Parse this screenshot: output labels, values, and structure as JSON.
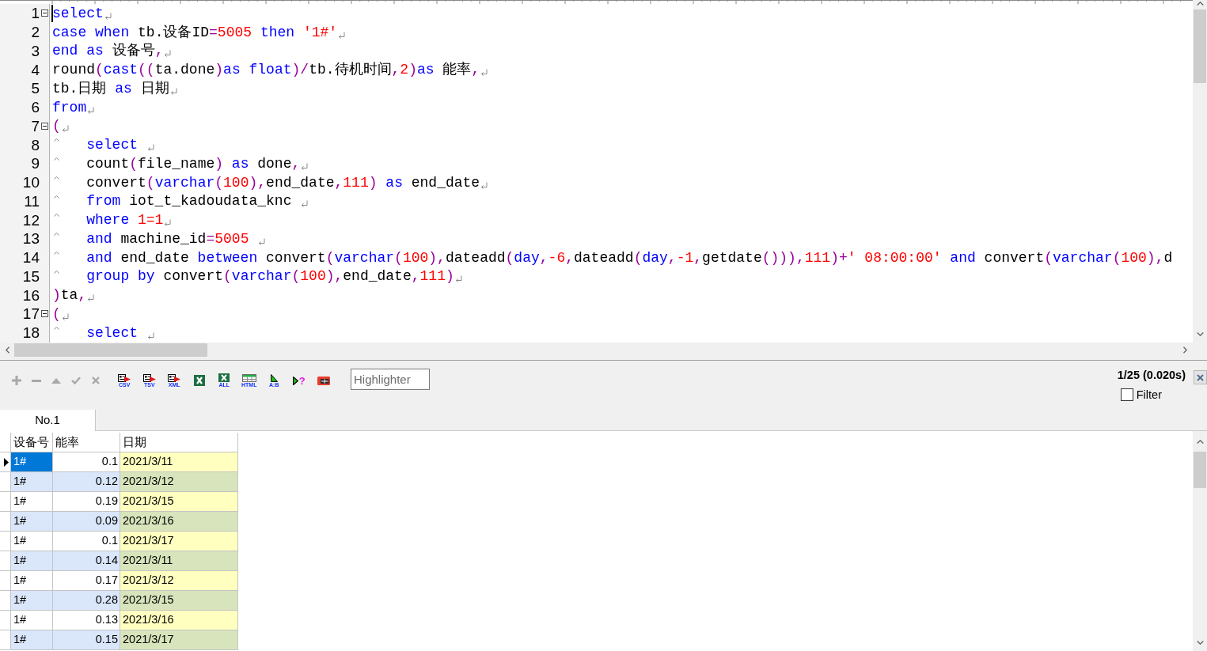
{
  "editor": {
    "lines": [
      {
        "number": "1",
        "fold": true,
        "indent": false,
        "cursor": true,
        "eol": true,
        "tokens": [
          {
            "kind": "keyword",
            "text": "select"
          }
        ]
      },
      {
        "number": "2",
        "fold": false,
        "indent": false,
        "cursor": false,
        "eol": true,
        "tokens": [
          {
            "kind": "keyword",
            "text": "case"
          },
          {
            "kind": "keyword",
            "text": " when"
          },
          {
            "kind": "plain",
            "text": " tb.设备ID"
          },
          {
            "kind": "operator",
            "text": "="
          },
          {
            "kind": "literal",
            "text": "5005"
          },
          {
            "kind": "keyword",
            "text": " then"
          },
          {
            "kind": "literal",
            "text": " '1#'"
          }
        ]
      },
      {
        "number": "3",
        "fold": false,
        "indent": false,
        "cursor": false,
        "eol": true,
        "tokens": [
          {
            "kind": "keyword",
            "text": "end"
          },
          {
            "kind": "keyword",
            "text": " as"
          },
          {
            "kind": "plain",
            "text": " 设备号"
          },
          {
            "kind": "operator",
            "text": ","
          }
        ]
      },
      {
        "number": "4",
        "fold": false,
        "indent": false,
        "cursor": false,
        "eol": true,
        "tokens": [
          {
            "kind": "plain",
            "text": "round"
          },
          {
            "kind": "operator",
            "text": "("
          },
          {
            "kind": "keyword",
            "text": "cast"
          },
          {
            "kind": "operator",
            "text": "(("
          },
          {
            "kind": "plain",
            "text": "ta.done"
          },
          {
            "kind": "operator",
            "text": ")"
          },
          {
            "kind": "keyword",
            "text": "as"
          },
          {
            "kind": "keyword",
            "text": " float"
          },
          {
            "kind": "operator",
            "text": ")/"
          },
          {
            "kind": "plain",
            "text": "tb.待机时间"
          },
          {
            "kind": "operator",
            "text": ","
          },
          {
            "kind": "literal",
            "text": "2"
          },
          {
            "kind": "operator",
            "text": ")"
          },
          {
            "kind": "keyword",
            "text": "as"
          },
          {
            "kind": "plain",
            "text": " 能率"
          },
          {
            "kind": "operator",
            "text": ","
          }
        ]
      },
      {
        "number": "5",
        "fold": false,
        "indent": false,
        "cursor": false,
        "eol": true,
        "tokens": [
          {
            "kind": "plain",
            "text": "tb.日期"
          },
          {
            "kind": "keyword",
            "text": " as"
          },
          {
            "kind": "plain",
            "text": " 日期"
          }
        ]
      },
      {
        "number": "6",
        "fold": false,
        "indent": false,
        "cursor": false,
        "eol": true,
        "tokens": [
          {
            "kind": "keyword",
            "text": "from"
          }
        ]
      },
      {
        "number": "7",
        "fold": true,
        "indent": false,
        "cursor": false,
        "eol": true,
        "tokens": [
          {
            "kind": "operator",
            "text": "("
          }
        ]
      },
      {
        "number": "8",
        "fold": false,
        "indent": true,
        "cursor": false,
        "eol": true,
        "tokens": [
          {
            "kind": "keyword",
            "text": "select "
          }
        ]
      },
      {
        "number": "9",
        "fold": false,
        "indent": true,
        "cursor": false,
        "eol": true,
        "tokens": [
          {
            "kind": "plain",
            "text": "count"
          },
          {
            "kind": "operator",
            "text": "("
          },
          {
            "kind": "plain",
            "text": "file_name"
          },
          {
            "kind": "operator",
            "text": ")"
          },
          {
            "kind": "keyword",
            "text": " as"
          },
          {
            "kind": "plain",
            "text": " done"
          },
          {
            "kind": "operator",
            "text": ","
          }
        ]
      },
      {
        "number": "10",
        "fold": false,
        "indent": true,
        "cursor": false,
        "eol": true,
        "tokens": [
          {
            "kind": "plain",
            "text": "convert"
          },
          {
            "kind": "operator",
            "text": "("
          },
          {
            "kind": "keyword",
            "text": "varchar"
          },
          {
            "kind": "operator",
            "text": "("
          },
          {
            "kind": "literal",
            "text": "100"
          },
          {
            "kind": "operator",
            "text": "),"
          },
          {
            "kind": "plain",
            "text": "end_date"
          },
          {
            "kind": "operator",
            "text": ","
          },
          {
            "kind": "literal",
            "text": "111"
          },
          {
            "kind": "operator",
            "text": ")"
          },
          {
            "kind": "keyword",
            "text": " as"
          },
          {
            "kind": "plain",
            "text": " end_date"
          }
        ]
      },
      {
        "number": "11",
        "fold": false,
        "indent": true,
        "cursor": false,
        "eol": true,
        "tokens": [
          {
            "kind": "keyword",
            "text": "from"
          },
          {
            "kind": "plain",
            "text": " iot_t_kadoudata_knc "
          }
        ]
      },
      {
        "number": "12",
        "fold": false,
        "indent": true,
        "cursor": false,
        "eol": true,
        "tokens": [
          {
            "kind": "keyword",
            "text": "where"
          },
          {
            "kind": "literal",
            "text": " 1=1"
          }
        ]
      },
      {
        "number": "13",
        "fold": false,
        "indent": true,
        "cursor": false,
        "eol": true,
        "tokens": [
          {
            "kind": "keyword",
            "text": "and"
          },
          {
            "kind": "plain",
            "text": " machine_id"
          },
          {
            "kind": "operator",
            "text": "="
          },
          {
            "kind": "literal",
            "text": "5005 "
          }
        ]
      },
      {
        "number": "14",
        "fold": false,
        "indent": true,
        "cursor": false,
        "eol": false,
        "tokens": [
          {
            "kind": "keyword",
            "text": "and"
          },
          {
            "kind": "plain",
            "text": " end_date"
          },
          {
            "kind": "keyword",
            "text": " between"
          },
          {
            "kind": "plain",
            "text": " convert"
          },
          {
            "kind": "operator",
            "text": "("
          },
          {
            "kind": "keyword",
            "text": "varchar"
          },
          {
            "kind": "operator",
            "text": "("
          },
          {
            "kind": "literal",
            "text": "100"
          },
          {
            "kind": "operator",
            "text": "),"
          },
          {
            "kind": "plain",
            "text": "dateadd"
          },
          {
            "kind": "operator",
            "text": "("
          },
          {
            "kind": "keyword",
            "text": "day"
          },
          {
            "kind": "operator",
            "text": ","
          },
          {
            "kind": "literal",
            "text": "-6"
          },
          {
            "kind": "operator",
            "text": ","
          },
          {
            "kind": "plain",
            "text": "dateadd"
          },
          {
            "kind": "operator",
            "text": "("
          },
          {
            "kind": "keyword",
            "text": "day"
          },
          {
            "kind": "operator",
            "text": ","
          },
          {
            "kind": "literal",
            "text": "-1"
          },
          {
            "kind": "operator",
            "text": ","
          },
          {
            "kind": "plain",
            "text": "getdate"
          },
          {
            "kind": "operator",
            "text": "())),"
          },
          {
            "kind": "literal",
            "text": "111"
          },
          {
            "kind": "operator",
            "text": ")+"
          },
          {
            "kind": "literal",
            "text": "' 08:00:00'"
          },
          {
            "kind": "keyword",
            "text": " and"
          },
          {
            "kind": "plain",
            "text": " convert"
          },
          {
            "kind": "operator",
            "text": "("
          },
          {
            "kind": "keyword",
            "text": "varchar"
          },
          {
            "kind": "operator",
            "text": "("
          },
          {
            "kind": "literal",
            "text": "100"
          },
          {
            "kind": "operator",
            "text": "),"
          },
          {
            "kind": "plain",
            "text": "d"
          }
        ]
      },
      {
        "number": "15",
        "fold": false,
        "indent": true,
        "cursor": false,
        "eol": true,
        "tokens": [
          {
            "kind": "keyword",
            "text": "group"
          },
          {
            "kind": "keyword",
            "text": " by"
          },
          {
            "kind": "plain",
            "text": " convert"
          },
          {
            "kind": "operator",
            "text": "("
          },
          {
            "kind": "keyword",
            "text": "varchar"
          },
          {
            "kind": "operator",
            "text": "("
          },
          {
            "kind": "literal",
            "text": "100"
          },
          {
            "kind": "operator",
            "text": "),"
          },
          {
            "kind": "plain",
            "text": "end_date"
          },
          {
            "kind": "operator",
            "text": ","
          },
          {
            "kind": "literal",
            "text": "111"
          },
          {
            "kind": "operator",
            "text": ")"
          }
        ]
      },
      {
        "number": "16",
        "fold": false,
        "indent": false,
        "cursor": false,
        "eol": true,
        "tokens": [
          {
            "kind": "operator",
            "text": ")"
          },
          {
            "kind": "plain",
            "text": "ta"
          },
          {
            "kind": "operator",
            "text": ","
          }
        ]
      },
      {
        "number": "17",
        "fold": true,
        "indent": false,
        "cursor": false,
        "eol": true,
        "tokens": [
          {
            "kind": "operator",
            "text": "("
          }
        ]
      },
      {
        "number": "18",
        "fold": false,
        "indent": true,
        "cursor": false,
        "eol": true,
        "tokens": [
          {
            "kind": "keyword",
            "text": "select "
          }
        ]
      }
    ]
  },
  "toolbar": {
    "edit_buttons": [
      {
        "kind": "add",
        "disabled": true
      },
      {
        "kind": "remove",
        "disabled": true
      },
      {
        "kind": "up",
        "disabled": true
      },
      {
        "kind": "confirm",
        "disabled": true
      },
      {
        "kind": "cancel",
        "disabled": true
      }
    ],
    "export_buttons": [
      {
        "kind": "document",
        "badge": "CSV"
      },
      {
        "kind": "document",
        "badge": "TSV"
      },
      {
        "kind": "document",
        "badge": "XML"
      },
      {
        "kind": "spreadsheet"
      },
      {
        "kind": "spreadsheet",
        "badge": "ALL"
      },
      {
        "kind": "table",
        "badge": "HTML"
      },
      {
        "kind": "compare",
        "badge": "A:B"
      },
      {
        "kind": "help",
        "badge": "?"
      },
      {
        "kind": "window"
      }
    ],
    "highlighter": {
      "placeholder": "Highlighter"
    },
    "status": "1/25 (0.020s)",
    "filter": {
      "label": "Filter",
      "checked": false
    }
  },
  "result_tabs": [
    {
      "label": "No.1",
      "selected": true
    }
  ],
  "grid": {
    "columns": [
      "设备号",
      "能率",
      "日期"
    ],
    "rows": [
      {
        "cells": [
          "1#",
          "0.1",
          "2021/3/11"
        ],
        "selected": true
      },
      {
        "cells": [
          "1#",
          "0.12",
          "2021/3/12"
        ],
        "selected": false
      },
      {
        "cells": [
          "1#",
          "0.19",
          "2021/3/15"
        ],
        "selected": false
      },
      {
        "cells": [
          "1#",
          "0.09",
          "2021/3/16"
        ],
        "selected": false
      },
      {
        "cells": [
          "1#",
          "0.1",
          "2021/3/17"
        ],
        "selected": false
      },
      {
        "cells": [
          "1#",
          "0.14",
          "2021/3/11"
        ],
        "selected": false
      },
      {
        "cells": [
          "1#",
          "0.17",
          "2021/3/12"
        ],
        "selected": false
      },
      {
        "cells": [
          "1#",
          "0.28",
          "2021/3/15"
        ],
        "selected": false
      },
      {
        "cells": [
          "1#",
          "0.13",
          "2021/3/16"
        ],
        "selected": false
      },
      {
        "cells": [
          "1#",
          "0.15",
          "2021/3/17"
        ],
        "selected": false
      }
    ]
  }
}
